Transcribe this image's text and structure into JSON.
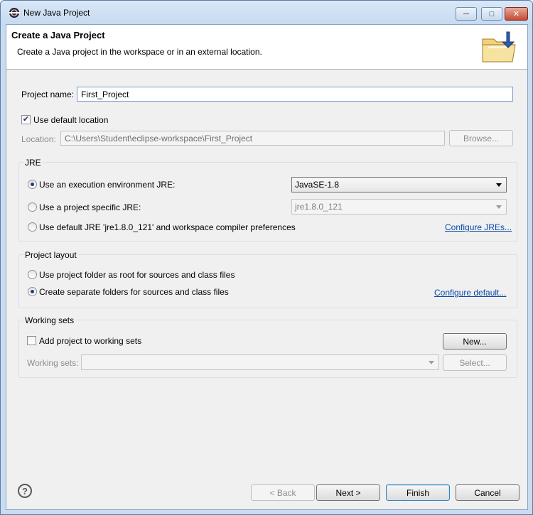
{
  "window": {
    "title": "New Java Project",
    "controls": {
      "minimize": "─",
      "maximize": "□",
      "close": "✕"
    }
  },
  "header": {
    "title": "Create a Java Project",
    "description": "Create a Java project in the workspace or in an external location.",
    "icon": "new-java-project-folder-icon"
  },
  "project": {
    "name_label": "Project name:",
    "name_value": "First_Project",
    "use_default_location_label": "Use default location",
    "use_default_location_checked": true,
    "location_label": "Location:",
    "location_value": "C:\\Users\\Student\\eclipse-workspace\\First_Project",
    "browse_label": "Browse..."
  },
  "jre": {
    "group_title": "JRE",
    "option_env_label": "Use an execution environment JRE:",
    "option_env_value": "JavaSE-1.8",
    "option_specific_label": "Use a project specific JRE:",
    "option_specific_value": "jre1.8.0_121",
    "option_default_label": "Use default JRE 'jre1.8.0_121' and workspace compiler preferences",
    "selected": "env",
    "configure_link": "Configure JREs..."
  },
  "layout": {
    "group_title": "Project layout",
    "option_root_label": "Use project folder as root for sources and class files",
    "option_separate_label": "Create separate folders for sources and class files",
    "selected": "separate",
    "configure_link": "Configure default..."
  },
  "working_sets": {
    "group_title": "Working sets",
    "add_label": "Add project to working sets",
    "add_checked": false,
    "new_button": "New...",
    "sets_label": "Working sets:",
    "sets_value": "",
    "select_button": "Select..."
  },
  "footer": {
    "help_icon": "help-icon",
    "back": "< Back",
    "next": "Next >",
    "finish": "Finish",
    "cancel": "Cancel"
  }
}
